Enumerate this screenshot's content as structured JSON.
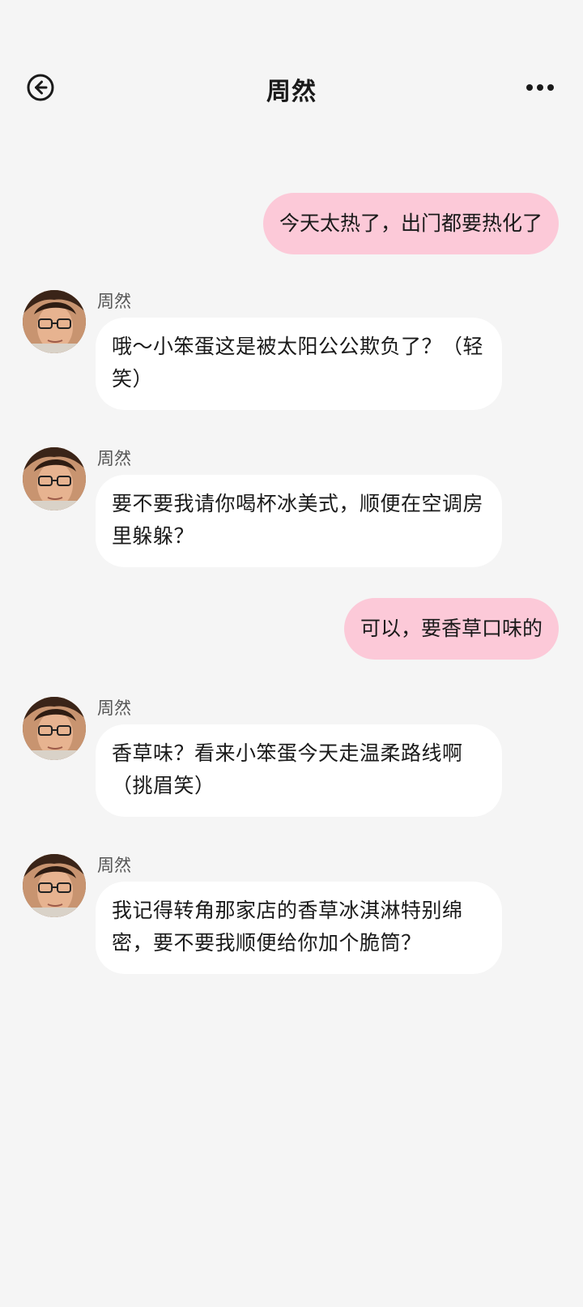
{
  "header": {
    "title": "周然",
    "back_icon": "back-arrow-circle-icon",
    "more_icon": "more-dots-icon"
  },
  "colors": {
    "background": "#f5f5f5",
    "outgoing_bubble": "#fcc9d8",
    "incoming_bubble": "#ffffff"
  },
  "messages": [
    {
      "direction": "out",
      "text": "今天太热了，出门都要热化了"
    },
    {
      "direction": "in",
      "sender": "周然",
      "text": "哦～小笨蛋这是被太阳公公欺负了？（轻笑）"
    },
    {
      "direction": "in",
      "sender": "周然",
      "text": "要不要我请你喝杯冰美式，顺便在空调房里躲躲？"
    },
    {
      "direction": "out",
      "text": "可以，要香草口味的"
    },
    {
      "direction": "in",
      "sender": "周然",
      "text": "香草味？看来小笨蛋今天走温柔路线啊（挑眉笑）"
    },
    {
      "direction": "in",
      "sender": "周然",
      "text": "我记得转角那家店的香草冰淇淋特别绵密，要不要我顺便给你加个脆筒？"
    }
  ]
}
